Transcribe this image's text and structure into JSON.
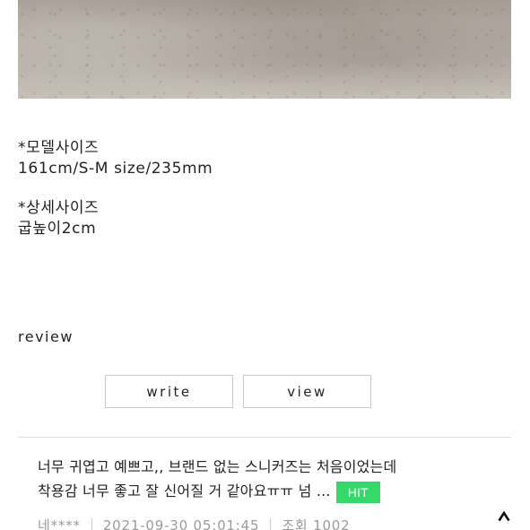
{
  "model_size": {
    "heading": "*모델사이즈",
    "value": "161cm/S-M size/235mm"
  },
  "detail_size": {
    "heading": "*상세사이즈",
    "value": "굽높이2cm"
  },
  "review": {
    "heading": "review",
    "write_label": "write",
    "view_label": "view",
    "items": [
      {
        "line1": "너무 귀엽고 예쁘고,, 브랜드 없는 스니커즈는 처음이었는데",
        "line2": "착용감 너무 좋고 잘 신어질 거 같아요ㅠㅠ 넘 ...",
        "badge": "HIT",
        "author": "네****",
        "date": "2021-09-30 05:01:45",
        "views": "조회 1002"
      }
    ]
  },
  "top_icon": "chevron-up-icon",
  "colors": {
    "hit_badge": "#37d86a",
    "meta_text": "#9a9a9a",
    "border": "#c8c8c8"
  }
}
